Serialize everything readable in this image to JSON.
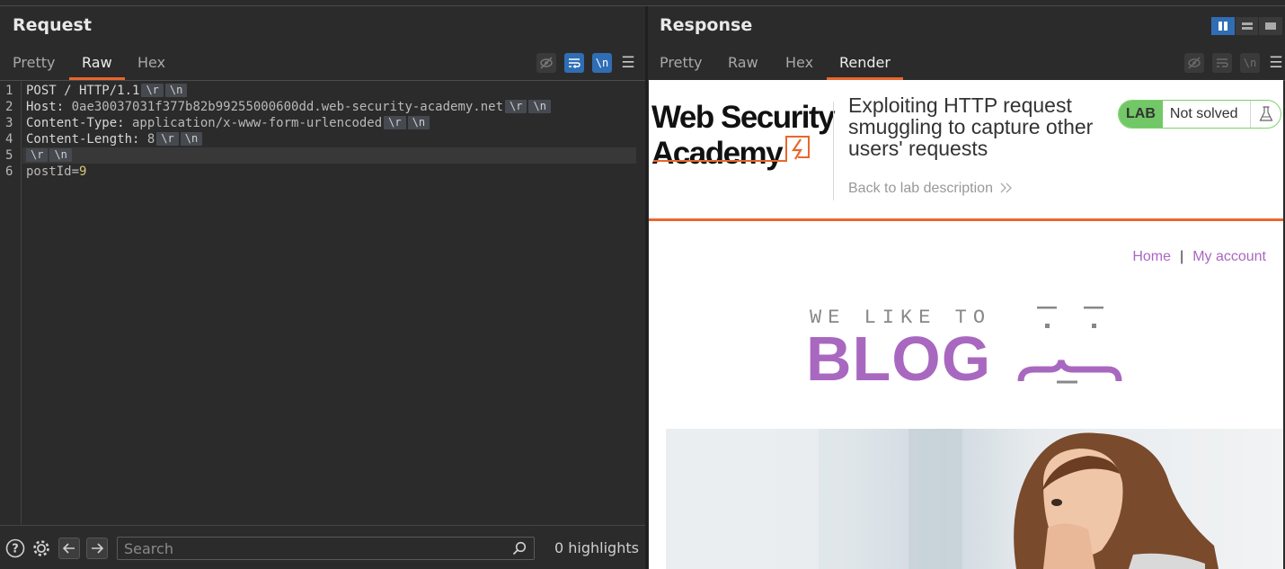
{
  "request": {
    "title": "Request",
    "tabs": [
      {
        "label": "Pretty",
        "active": false
      },
      {
        "label": "Raw",
        "active": true
      },
      {
        "label": "Hex",
        "active": false
      }
    ],
    "lines": [
      {
        "num": "1",
        "key": "POST / HTTP/1.1",
        "value": ""
      },
      {
        "num": "2",
        "key": "Host:",
        "value": " 0ae30037031f377b82b99255000600dd.web-security-academy.net"
      },
      {
        "num": "3",
        "key": "Content-Type:",
        "value": " application/x-www-form-urlencoded"
      },
      {
        "num": "4",
        "key": "Content-Length:",
        "value": " 8"
      },
      {
        "num": "5",
        "key": "",
        "value": ""
      },
      {
        "num": "6",
        "key": "postId=",
        "value": "9"
      }
    ],
    "escape_cr": "\\r",
    "escape_lf": "\\n",
    "newline_toggle": "\\n",
    "search_placeholder": "Search",
    "highlights": "0 highlights"
  },
  "response": {
    "title": "Response",
    "tabs": [
      {
        "label": "Pretty",
        "active": false
      },
      {
        "label": "Raw",
        "active": false
      },
      {
        "label": "Hex",
        "active": false
      },
      {
        "label": "Render",
        "active": true
      }
    ],
    "newline_toggle": "\\n",
    "render": {
      "logo_line1": "Web Security",
      "logo_line2": "Academy",
      "lab_title": "Exploiting HTTP request smuggling to capture other users' requests",
      "back_link": "Back to lab description",
      "lab_label": "LAB",
      "lab_status": "Not solved",
      "nav_home": "Home",
      "nav_sep": "|",
      "nav_account": "My account",
      "blog_tagline": "WE LIKE TO",
      "blog_word": "BLOG"
    }
  },
  "colors": {
    "accent_orange": "#e8672c",
    "active_blue": "#2f6eb5",
    "blog_purple": "#a968bf",
    "lab_green": "#72c766"
  }
}
